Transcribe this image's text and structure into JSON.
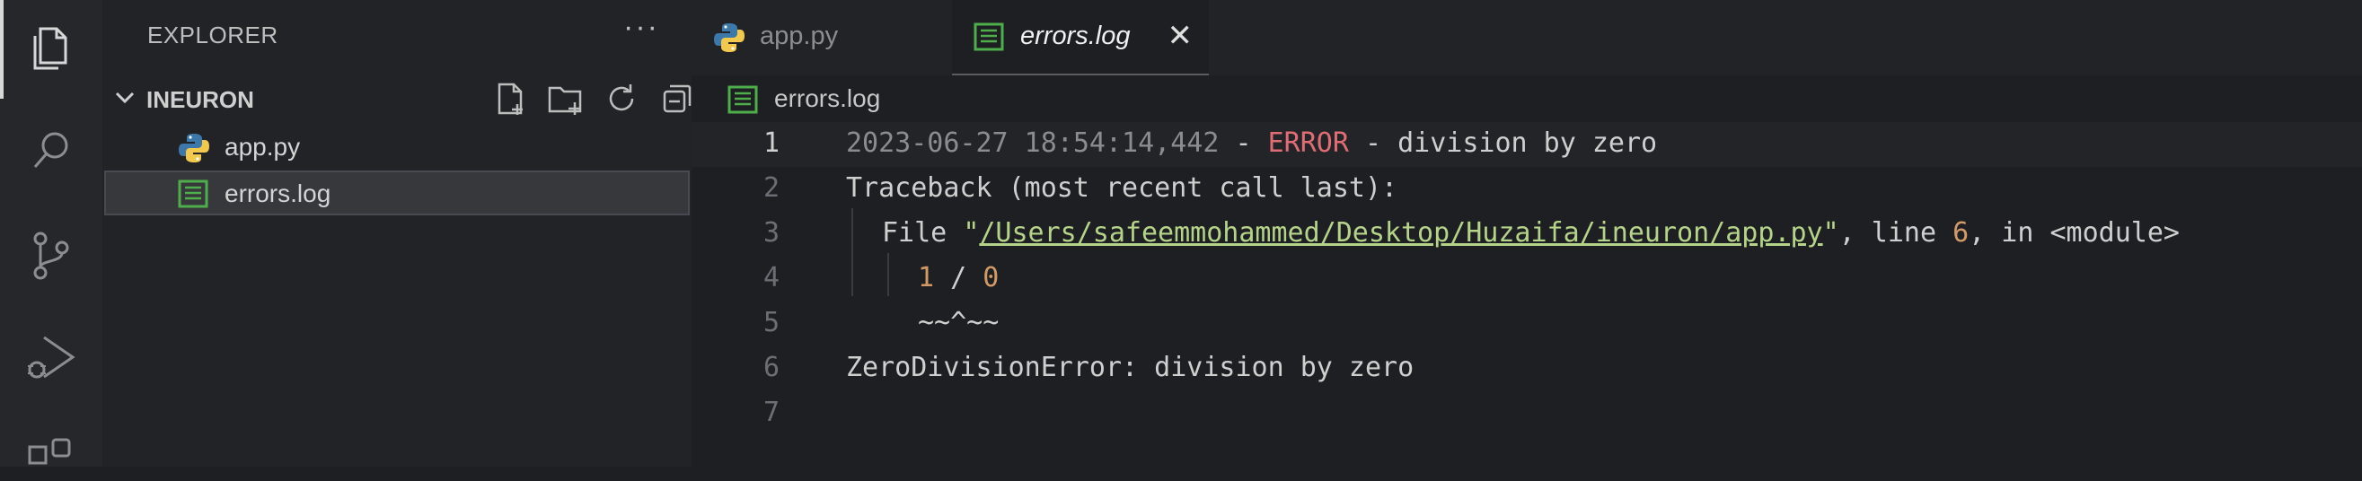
{
  "sidebar": {
    "title": "EXPLORER",
    "more": "···",
    "folder": "INEURON",
    "files": [
      {
        "name": "app.py",
        "type": "python"
      },
      {
        "name": "errors.log",
        "type": "log"
      }
    ]
  },
  "tabs": [
    {
      "label": "app.py",
      "active": false
    },
    {
      "label": "errors.log",
      "active": true
    }
  ],
  "breadcrumb": "errors.log",
  "code": {
    "line_numbers": [
      "1",
      "2",
      "3",
      "4",
      "5",
      "6",
      "7"
    ],
    "l1_date": "2023-06-27 18:54:14,442",
    "l1_dash1": " - ",
    "l1_level": "ERROR",
    "l1_msg": " - division by zero",
    "l2": "Traceback (most recent call last):",
    "l3_prefix": "File ",
    "l3_q1": "\"",
    "l3_path": "/Users/safeemmohammed/Desktop/Huzaifa/ineuron/app.py",
    "l3_q2": "\"",
    "l3_mid": ", line ",
    "l3_line": "6",
    "l3_suffix": ", in <module>",
    "l4_a": "1",
    "l4_op": " / ",
    "l4_b": "0",
    "l5": "~~^~~",
    "l6": "ZeroDivisionError: division by zero",
    "l7": ""
  },
  "colors": {
    "error": "#e06c75",
    "path": "#b5d48a",
    "number": "#d19a66",
    "date": "#8a8c91"
  }
}
